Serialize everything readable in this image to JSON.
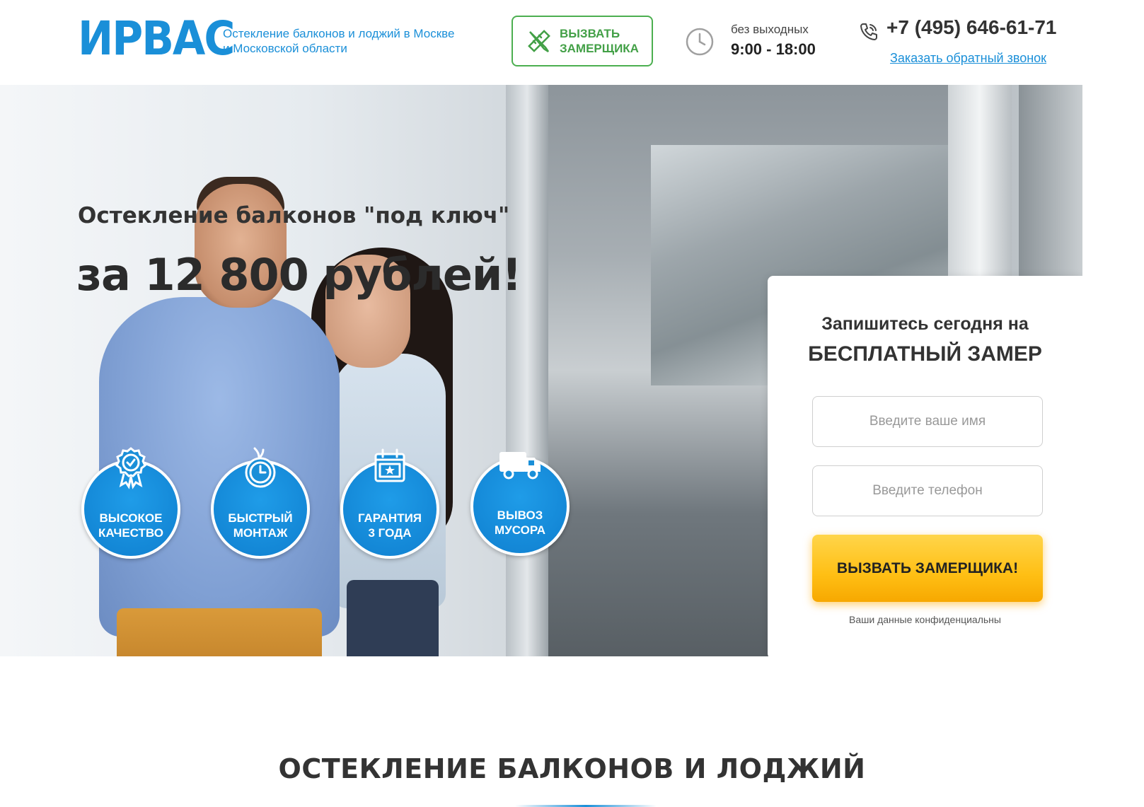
{
  "header": {
    "logo": "ИРВАС",
    "tagline": [
      "Остекление балконов и лоджий в Москве",
      "и Московской области"
    ],
    "call_button": [
      "ВЫЗВАТЬ",
      "ЗАМЕРЩИКА"
    ],
    "hours_label": "без выходных",
    "hours_value": "9:00 - 18:00",
    "phone": "+7 (495) 646-61-71",
    "callback_link": "Заказать обратный звонок",
    "icons": {
      "call_button": "ruler-pencil-icon",
      "hours": "clock-icon",
      "phone": "phone-icon"
    }
  },
  "hero": {
    "subtitle": "Остекление балконов \"под ключ\"",
    "title": "за 12 800 рублей!",
    "features": [
      {
        "label": [
          "ВЫСОКОЕ",
          "КАЧЕСТВО"
        ],
        "icon": "badge-check-icon"
      },
      {
        "label": [
          "БЫСТРЫЙ",
          "МОНТАЖ"
        ],
        "icon": "stopwatch-icon"
      },
      {
        "label": [
          "ГАРАНТИЯ",
          "3 ГОДА"
        ],
        "icon": "calendar-star-icon"
      },
      {
        "label": [
          "ВЫВОЗ",
          "МУСОРА"
        ],
        "icon": "truck-icon"
      }
    ]
  },
  "form": {
    "title_line1": "Запишитесь сегодня на",
    "title_line2": "БЕСПЛАТНЫЙ ЗАМЕР",
    "name_placeholder": "Введите ваше имя",
    "phone_placeholder": "Введите телефон",
    "submit_label": "ВЫЗВАТЬ ЗАМЕРЩИКА!",
    "privacy_note": "Ваши данные конфиденциальны"
  },
  "section": {
    "title": "ОСТЕКЛЕНИЕ БАЛКОНОВ И ЛОДЖИЙ"
  },
  "colors": {
    "brand_blue": "#1a8fd8",
    "green": "#43a047",
    "yellow": "#ffbf14"
  }
}
